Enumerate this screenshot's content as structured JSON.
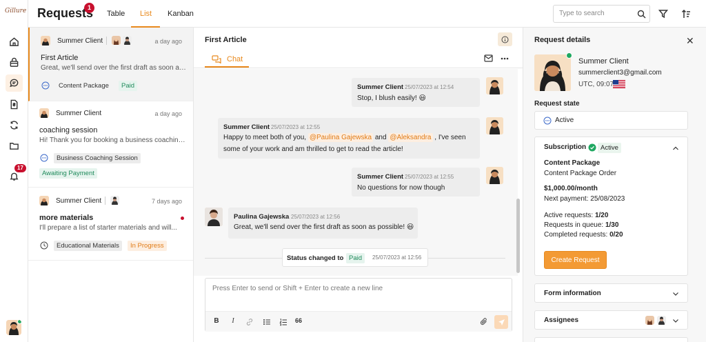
{
  "app": {
    "title": "Requests",
    "title_badge": "1",
    "logo_text": "Gillure",
    "notification_count": "17"
  },
  "tabs": [
    {
      "label": "Table"
    },
    {
      "label": "List"
    },
    {
      "label": "Kanban"
    }
  ],
  "search": {
    "placeholder": "Type to search",
    "value": ""
  },
  "requests": [
    {
      "client": "Summer Client",
      "time": "a day ago",
      "title": "First Article",
      "snippet": "Great, we'll send over the first draft as soon as...",
      "package": "Content Package",
      "status": "Paid",
      "selected": true
    },
    {
      "client": "Summer Client",
      "time": "a day ago",
      "title": "coaching session",
      "snippet": "Hi! Thank you for booking a business coaching...",
      "package": "Business Coaching Session",
      "status": "Awaiting Payment",
      "selected": false
    },
    {
      "client": "Summer Client",
      "time": "7 days ago",
      "title": "more materials",
      "snippet": "I'll prepare a list of starter materials and will...",
      "package": "Educational Materials",
      "status": "In Progress",
      "selected": false,
      "unread": true
    }
  ],
  "chat": {
    "title": "First Article",
    "tab_label": "Chat",
    "messages": [
      {
        "author": "Summer Client",
        "time": "25/07/2023 at 12:54",
        "text": "Stop, I blush easily! 😃"
      },
      {
        "author": "Summer Client",
        "time": "25/07/2023 at 12:55",
        "text_before": "Happy to meet both of you,",
        "mention1": "@Paulina Gajewska",
        "and": "and",
        "mention2": "@Aleksandra",
        "text_after": ", I've seen",
        "text_line2": "some of your work and am thrilled to get to read the article!"
      },
      {
        "author": "Summer Client",
        "time": "25/07/2023 at 12:55",
        "text": "No questions for now though"
      },
      {
        "author": "Paulina Gajewska",
        "time": "25/07/2023 at 12:56",
        "text": "Great, we'll send over the first draft as soon as possible! 😃"
      }
    ],
    "status_change": {
      "label": "Status changed to",
      "value": "Paid",
      "time": "25/07/2023 at 12:56"
    },
    "composer": {
      "placeholder": "Press Enter to send or Shift + Enter to create a new line",
      "value": ""
    },
    "format_buttons": [
      "B",
      "I",
      "link",
      "bullet-list",
      "numbered-list",
      "66"
    ]
  },
  "details": {
    "title": "Request details",
    "client_name": "Summer Client",
    "client_email": "summerclient3@gmail.com",
    "client_timezone": "UTC, 09:07",
    "request_state_label": "Request state",
    "request_state": "Active",
    "subscription": {
      "label": "Subscription",
      "status": "Active",
      "package": "Content Package",
      "order": "Content Package Order",
      "price": "$1,000.00/month",
      "next_payment_label": "Next payment:",
      "next_payment": "25/08/2023",
      "active_requests_label": "Active requests:",
      "active_requests": "1/20",
      "in_queue_label": "Requests in queue:",
      "in_queue": "1/30",
      "completed_label": "Completed requests:",
      "completed": "0/20",
      "create_button": "Create Request"
    },
    "form_information_label": "Form information",
    "assignees_label": "Assignees"
  },
  "colors": {
    "accent": "#e8891c",
    "badge_red": "#c8102e",
    "success_green": "#1fa861"
  }
}
